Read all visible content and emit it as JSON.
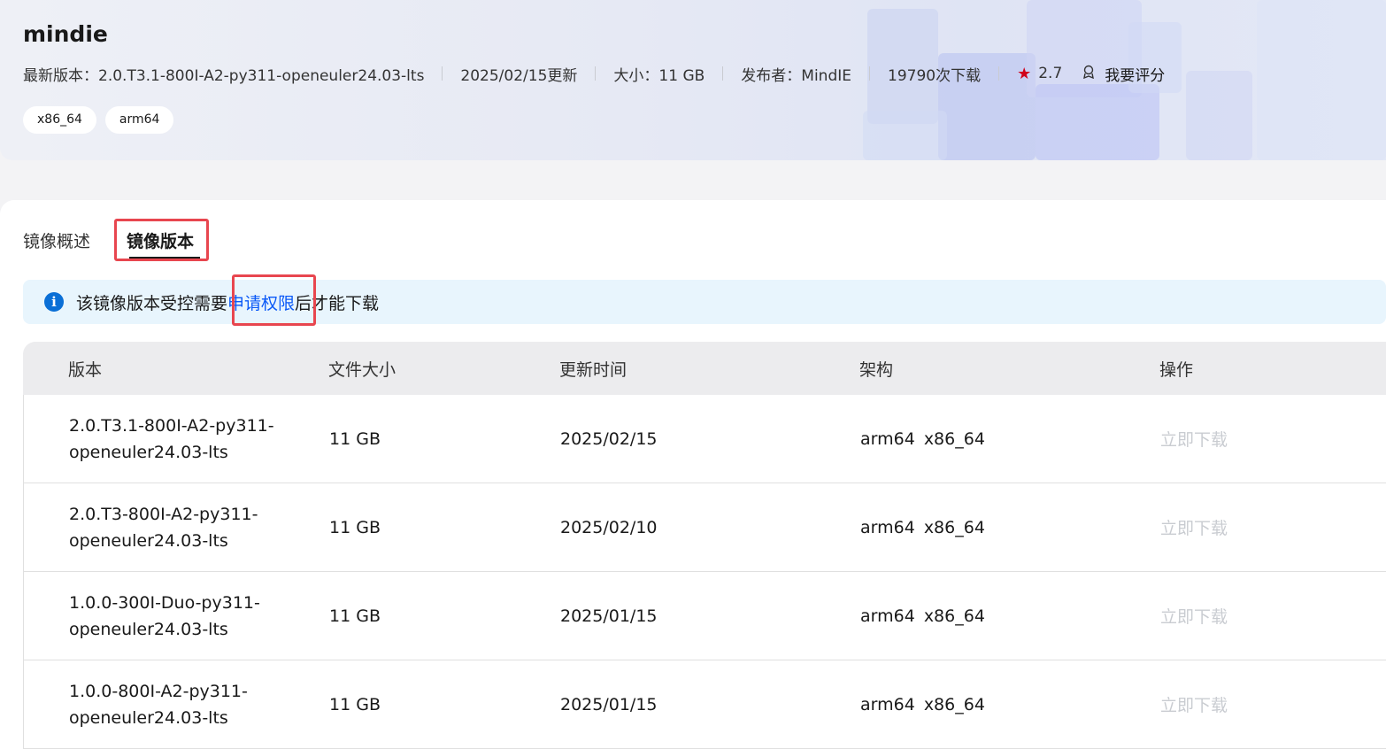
{
  "header": {
    "title": "mindie",
    "latest_version": "最新版本：2.0.T3.1-800I-A2-py311-openeuler24.03-lts",
    "update_date": "2025/02/15更新",
    "size": "大小：11 GB",
    "publisher": "发布者：MindIE",
    "downloads": "19790次下载",
    "rating": "2.7",
    "rate_link": "我要评分",
    "tags": [
      "x86_64",
      "arm64"
    ]
  },
  "tabs": [
    {
      "label": "镜像概述"
    },
    {
      "label": "镜像版本"
    }
  ],
  "notice": {
    "prefix": "该镜像版本受控需要",
    "link": "申请权限",
    "suffix": "后才能下载"
  },
  "table": {
    "headers": [
      "版本",
      "文件大小",
      "更新时间",
      "架构",
      "操作"
    ],
    "rows": [
      {
        "version_line1": "2.0.T3.1-800I-A2-py311-",
        "version_line2": "openeuler24.03-lts",
        "size": "11 GB",
        "date": "2025/02/15",
        "arch1": "arm64",
        "arch2": "x86_64",
        "action": "立即下载"
      },
      {
        "version_line1": "2.0.T3-800I-A2-py311-",
        "version_line2": "openeuler24.03-lts",
        "size": "11 GB",
        "date": "2025/02/10",
        "arch1": "arm64",
        "arch2": "x86_64",
        "action": "立即下载"
      },
      {
        "version_line1": "1.0.0-300I-Duo-py311-",
        "version_line2": "openeuler24.03-lts",
        "size": "11 GB",
        "date": "2025/01/15",
        "arch1": "arm64",
        "arch2": "x86_64",
        "action": "立即下载"
      },
      {
        "version_line1": "1.0.0-800I-A2-py311-",
        "version_line2": "openeuler24.03-lts",
        "size": "11 GB",
        "date": "2025/01/15",
        "arch1": "arm64",
        "arch2": "x86_64",
        "action": "立即下载"
      }
    ]
  },
  "colors": {
    "accent_link": "#0a59f7",
    "highlight_box": "#e8464f",
    "star": "#d0021b",
    "disabled_action": "#c9ccd1"
  }
}
